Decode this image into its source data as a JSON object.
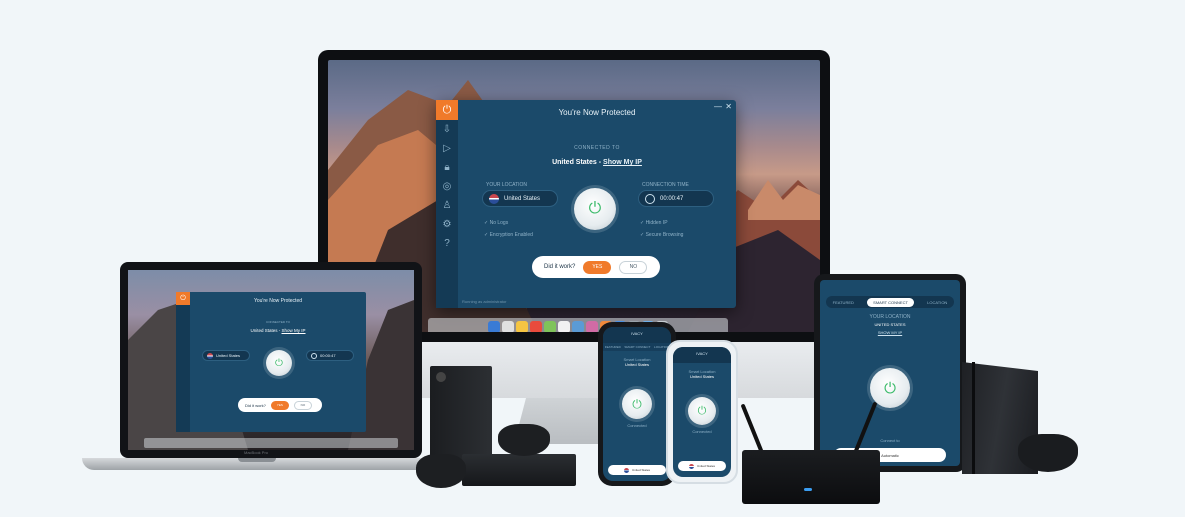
{
  "vpn_app": {
    "title": "You're Now Protected",
    "connected_to_label": "CONNECTED TO",
    "country": "United States",
    "separator": " - ",
    "show_ip": "Show My IP",
    "your_location_label": "YOUR LOCATION",
    "location_value": "United States",
    "connection_time_label": "CONNECTION TIME",
    "connection_time_value": "00:00:47",
    "left_checks": [
      "No Logs",
      "Encryption Enabled"
    ],
    "right_checks": [
      "Hidden IP",
      "Secure Browsing"
    ],
    "feedback_question": "Did it work?",
    "yes_label": "YES",
    "no_label": "NO",
    "footer": "Running as administrator",
    "window_controls": {
      "minimize": "—",
      "close": "✕"
    }
  },
  "laptop_app": {
    "title": "You're Now Protected",
    "connected_to_label": "CONNECTED TO",
    "country": "United States",
    "separator": " - ",
    "show_ip": "Show My IP",
    "location_value": "United States",
    "connection_time_value": "00:00:47",
    "feedback_question": "Did it work?",
    "yes_label": "YES",
    "no_label": "NO",
    "brand": "MacBook Pro"
  },
  "phone_left": {
    "title": "IVACY",
    "tabs": [
      "FEATURED",
      "SMART CONNECT",
      "LOCATION"
    ],
    "location_label": "Smart Location",
    "location_value": "United States",
    "connected": "Connected",
    "bottom": "United States"
  },
  "phone_right": {
    "title": "IVACY",
    "location_label": "Smart Location",
    "location_value": "United States",
    "connected": "Connected",
    "bottom": "United States"
  },
  "tablet": {
    "tabs": [
      "FEATURED",
      "SMART CONNECT",
      "LOCATION"
    ],
    "location_label": "YOUR LOCATION",
    "location_value": "UNITED STATES",
    "show_ip": "SHOW MY IP",
    "connect_label": "Connect to",
    "bottom": "Automatic"
  },
  "colors": {
    "app_bg": "#1b4a6a",
    "accent": "#f07a2a",
    "power_icon": "#3dbb6b"
  },
  "icons": [
    "power-icon",
    "download-icon",
    "play-icon",
    "lock-icon",
    "gear-icon",
    "user-icon",
    "help-icon",
    "apple-logo-icon"
  ]
}
